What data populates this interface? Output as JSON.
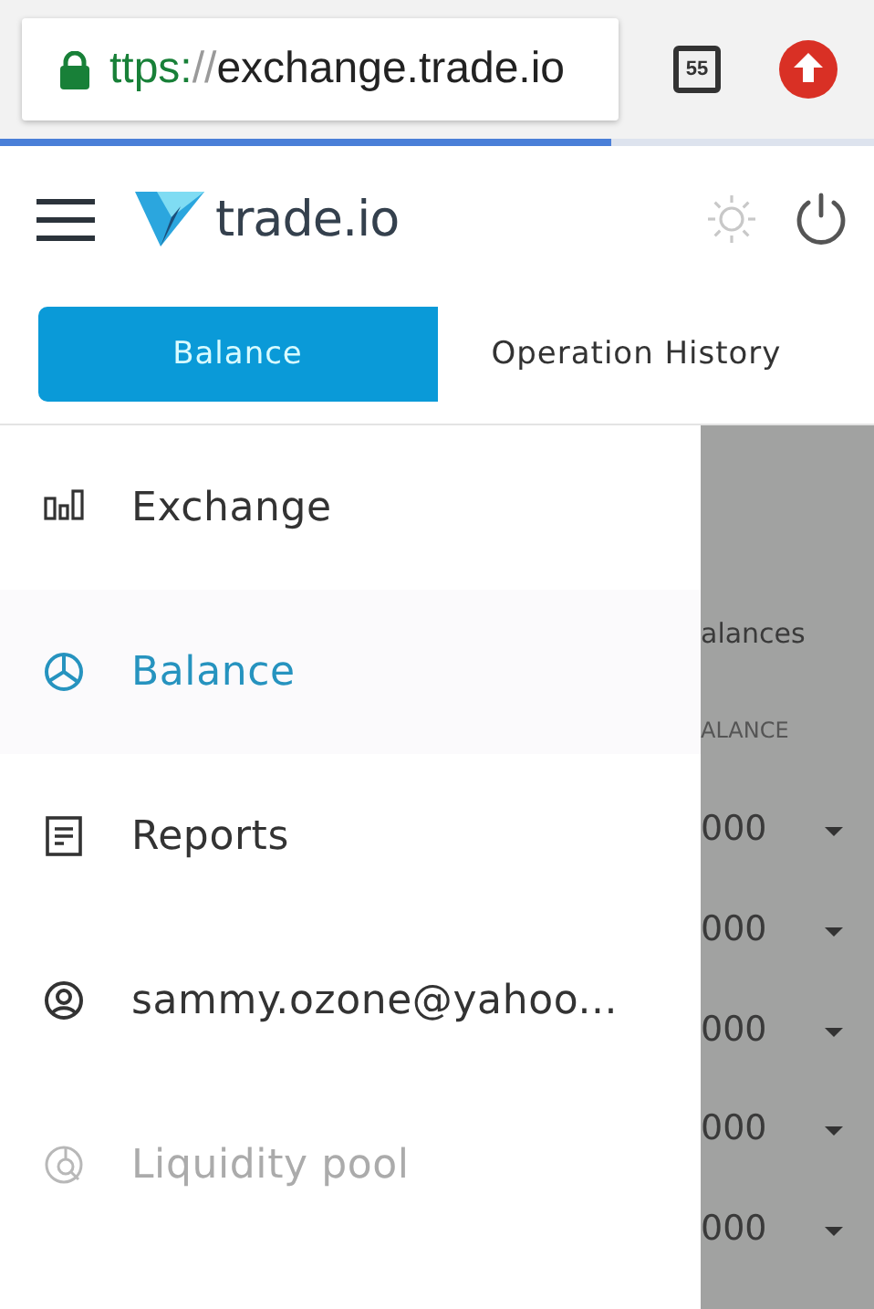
{
  "browser": {
    "url_scheme": "ttps:",
    "url_separator": "//",
    "url_host": "exchange.trade.io",
    "tab_count": "55",
    "load_progress": {
      "level": 0.7
    }
  },
  "header": {
    "logo_text": "trade.io"
  },
  "tabs": [
    {
      "label": "Balance",
      "selected": true
    },
    {
      "label": "Operation History",
      "selected": false
    }
  ],
  "drawer": {
    "items": [
      {
        "kind": "exchange",
        "label": "Exchange",
        "selected": false,
        "disabled": false
      },
      {
        "kind": "balance",
        "label": "Balance",
        "selected": true,
        "disabled": false
      },
      {
        "kind": "reports",
        "label": "Reports",
        "selected": false,
        "disabled": false
      },
      {
        "kind": "account",
        "label": "sammy.ozone@yahoo...",
        "selected": false,
        "disabled": false
      },
      {
        "kind": "pool",
        "label": "Liquidity pool",
        "selected": false,
        "disabled": true
      }
    ]
  },
  "background_page": {
    "heading": "alances",
    "column_header": "ALANCE",
    "rows": [
      "000",
      "000",
      "000",
      "000",
      "000"
    ]
  }
}
